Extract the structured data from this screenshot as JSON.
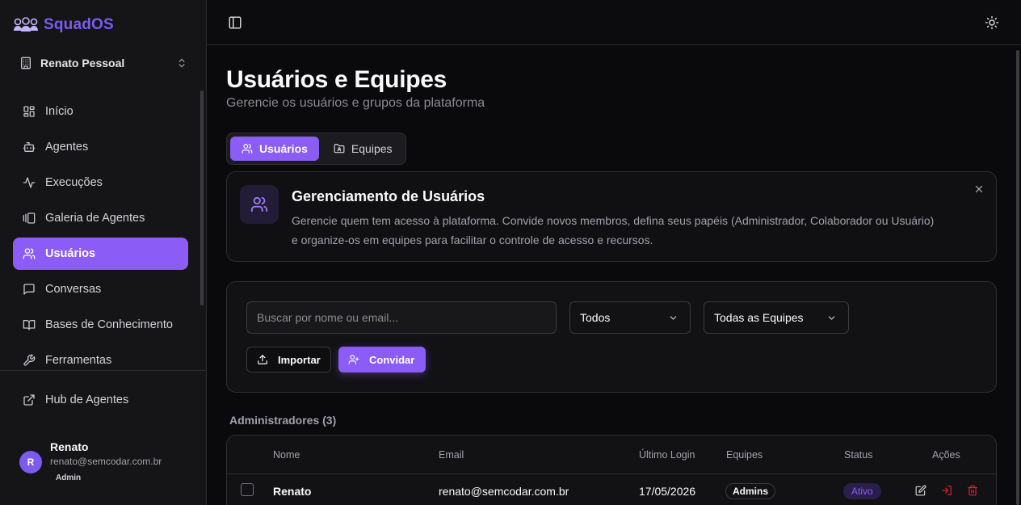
{
  "app": {
    "name": "SquadOS",
    "brand_color": "#7c5cf0"
  },
  "workspace": {
    "name": "Renato Pessoal"
  },
  "sidebar": {
    "items": [
      {
        "label": "Início",
        "icon": "dashboard-icon"
      },
      {
        "label": "Agentes",
        "icon": "bot-icon"
      },
      {
        "label": "Execuções",
        "icon": "activity-icon"
      },
      {
        "label": "Galeria de Agentes",
        "icon": "gallery-icon"
      },
      {
        "label": "Usuários",
        "icon": "users-icon",
        "active": true
      },
      {
        "label": "Conversas",
        "icon": "chat-icon"
      },
      {
        "label": "Bases de Conhecimento",
        "icon": "book-icon"
      },
      {
        "label": "Ferramentas",
        "icon": "wrench-icon"
      }
    ],
    "hub": {
      "label": "Hub de Agentes",
      "icon": "external-link-icon"
    },
    "user": {
      "initial": "R",
      "name": "Renato",
      "email": "renato@semcodar.com.br",
      "role": "Admin"
    }
  },
  "page": {
    "title": "Usuários e Equipes",
    "subtitle": "Gerencie os usuários e grupos da plataforma"
  },
  "tabs": [
    {
      "label": "Usuários",
      "active": true
    },
    {
      "label": "Equipes",
      "active": false
    }
  ],
  "info": {
    "title": "Gerenciamento de Usuários",
    "text": "Gerencie quem tem acesso à plataforma. Convide novos membros, defina seus papéis (Administrador, Colaborador ou Usuário) e organize-os em equipes para facilitar o controle de acesso e recursos."
  },
  "filters": {
    "search_placeholder": "Buscar por nome ou email...",
    "role_select": "Todos",
    "team_select": "Todas as Equipes",
    "import_label": "Importar",
    "invite_label": "Convidar"
  },
  "section": {
    "label": "Administradores (3)"
  },
  "table": {
    "columns": [
      "Nome",
      "Email",
      "Último Login",
      "Equipes",
      "Status",
      "Ações"
    ],
    "rows": [
      {
        "name": "Renato",
        "email": "renato@semcodar.com.br",
        "last_login": "17/05/2026",
        "team": "Admins",
        "status": "Ativo"
      }
    ]
  },
  "colors": {
    "accent": "#8b5cf6",
    "danger": "#dc2626",
    "status_active": "#8b5cf6"
  }
}
